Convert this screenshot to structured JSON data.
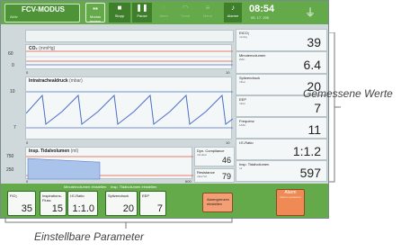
{
  "header": {
    "mode_title": "FCV-MODUS",
    "mode_sub": "Aktiv",
    "buttons": [
      {
        "label": "Modus ändern"
      },
      {
        "label": "Stopp"
      },
      {
        "label": "Pause"
      },
      {
        "label": "Atem"
      },
      {
        "label": "Trend"
      },
      {
        "label": "Menü"
      },
      {
        "label": "Alarme"
      }
    ],
    "time": "08:54",
    "date": "05. 17. 205"
  },
  "charts": [
    {
      "title": "CO₂",
      "unit": "(mmHg)",
      "y_ticks": [
        "60",
        "0"
      ],
      "x_ticks": [
        "0",
        "10"
      ]
    },
    {
      "title": "Intratrachealdruck",
      "unit": "(mbar)",
      "y_ticks": [
        "10",
        "7"
      ],
      "x_ticks": [
        "0",
        "10"
      ]
    },
    {
      "title": "Insp. Tidalvolumen",
      "unit": "(ml)",
      "y_ticks": [
        "750",
        "250"
      ],
      "x_ticks": [
        "0",
        "600"
      ]
    }
  ],
  "side_small": [
    {
      "label": "Dyn. Compliance",
      "unit": "ml/mbar",
      "value": "46"
    },
    {
      "label": "Resistance",
      "unit": "mbar*s/l",
      "value": "79"
    }
  ],
  "measured": [
    {
      "label": "EtCO₂",
      "unit": "mmHg",
      "value": "39"
    },
    {
      "label": "Minutenvolumen",
      "unit": "l/Min",
      "value": "6.4"
    },
    {
      "label": "Spitzendruck",
      "unit": "mbar",
      "value": "20"
    },
    {
      "label": "EEP",
      "unit": "mbar",
      "value": "7"
    },
    {
      "label": "Frequenz",
      "unit": "1/Min",
      "value": "11"
    },
    {
      "label": "I:E-Ratio",
      "unit": "",
      "value": "1:1.2"
    },
    {
      "label": "Insp. Tidalvolumen",
      "unit": "ml",
      "value": "597"
    }
  ],
  "settings": {
    "group1_label": "Minutenvolumen einstellen",
    "group2_label": "Insp. Tidalvolumen einstellen",
    "params": [
      {
        "label": "FiO₂",
        "unit": "%",
        "value": "35"
      },
      {
        "label": "Inspirations-Fluss",
        "unit": "l/min",
        "value": "15"
      },
      {
        "label": "I:E-Ratio",
        "unit": "",
        "value": "1:1.0"
      },
      {
        "label": "Spitzendruck",
        "unit": "mbar",
        "value": "20"
      },
      {
        "label": "EEP",
        "unit": "mbar",
        "value": "7"
      }
    ],
    "alarm_limits_label": "Alarmgrenzen einstellen",
    "alarm_button": "Alarm",
    "alarm_button_sub": "Alarme pausieren"
  },
  "annotations": {
    "measured": "Gemessene Werte",
    "settable": "Einstellbare Parameter"
  },
  "colors": {
    "header_green": "#64a94a",
    "alarm_orange": "#ef8a55",
    "wave_blue": "#4a6fc9",
    "limit_red": "#e0533b"
  }
}
